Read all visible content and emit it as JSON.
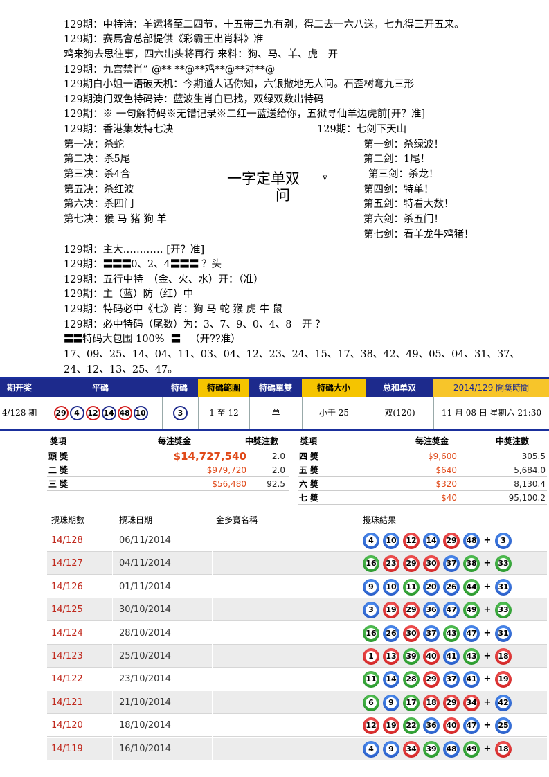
{
  "text_lines": {
    "l1": "129期：中特诗：羊运将至二四节，十五带三九有别，得二去一六八送，七九得三开五来。",
    "l2": "129期：赛馬會总部提供《彩霸王出肖料》准",
    "l3": "鸡来狗去思往事，四六出头将再行 来料：狗、马、羊、虎　开",
    "l4": "129期：九宫禁肖” @** **@**鸡**@**对**@",
    "l5": "129期白小姐一语破天机：今期道人话你知，六银撒地无人问。石歪树弯九三形",
    "l6": "129期澳门双色特码诗：蓝波生肖自已找，双绿双数出特码",
    "l7": "129期：※ 一句解特码※无错记录※二红一蓝送给你，五狱寻仙羊边虎前[开？准]",
    "l8a": "129期：香港集发特七决",
    "l8b": "129期：七剑下天山",
    "j1": "第一决：杀蛇",
    "j2": "第二决：杀5尾",
    "j3": "第三决：杀4合",
    "j4": "第五决：杀红波",
    "j5": "第六决：杀四门",
    "j6": "第七决：猴 马 猪 狗 羊",
    "s1": "第一剑：杀绿波！",
    "s2": "第二剑：1尾！",
    "s3": "第三剑：杀龙！",
    "s4": "第四剑：特单！",
    "s5": "第五剑：特看大数！",
    "s6": "第六剑：杀五门！",
    "s7": "第七剑：看羊龙牛鸡猪！",
    "big1": "一字定单双",
    "big2": "问",
    "vmark": "v",
    "m1": "129期：主大………… [开？准]",
    "m2a": "129期：",
    "m2bars1": "〓〓〓",
    "m2b": "0、2、4",
    "m2bars2": "〓〓〓",
    "m2c": " ？头",
    "m3": "129期：五行中特　（金、火、水）开：（准）",
    "m4": "129期：主（蓝）防（红）中",
    "m5": "129期：特码必中《七》肖：狗 马 蛇 猴 虎 牛 鼠",
    "m6": "129期：必中特码（尾数）为：3、7、9、0、4、8　开 ？",
    "m7bars1": "〓〓",
    "m7": "特码大包围 100%",
    "m7bars2": "〓",
    "m7c": "（开??准）",
    "m8": "17、09、25、14、04、11、03、04、12、23、24、15、17、38、42、49、05、04、31、37、",
    "m9": "24、12、13、25、47。"
  },
  "results_header": {
    "h_period": "期开奖",
    "h_normal": "平碼",
    "h_special": "特碼",
    "h_range": "特碼範圍",
    "h_oddeven": "特碼單雙",
    "h_size": "特碼大小",
    "h_sum": "总和单双",
    "h_next": "2014/129 開獎時間",
    "period": "4/128 期",
    "normal_balls": [
      "29",
      "4",
      "12",
      "14",
      "48",
      "10"
    ],
    "special_ball": "3",
    "range": "1 至 12",
    "oddeven": "单",
    "size": "小于 25",
    "sum": "双(120)",
    "next_time": "11 月 08 日 星期六 21:30"
  },
  "prize_table": {
    "left_headers": [
      "獎項",
      "每注獎金",
      "中獎注數"
    ],
    "right_headers": [
      "獎項",
      "每注獎金",
      "中獎注數"
    ],
    "left_rows": [
      {
        "name": "頭 獎",
        "amount": "$14,727,540",
        "count": "2.0"
      },
      {
        "name": "二 獎",
        "amount": "$979,720",
        "count": "2.0"
      },
      {
        "name": "三 獎",
        "amount": "$56,480",
        "count": "92.5"
      }
    ],
    "right_rows": [
      {
        "name": "四 獎",
        "amount": "$9,600",
        "count": "305.5"
      },
      {
        "name": "五 獎",
        "amount": "$640",
        "count": "5,684.0"
      },
      {
        "name": "六 獎",
        "amount": "$320",
        "count": "8,130.4"
      },
      {
        "name": "七 獎",
        "amount": "$40",
        "count": "95,100.2"
      }
    ]
  },
  "draws": {
    "headers": [
      "攪珠期數",
      "攪珠日期",
      "金多寶名稱",
      "攪珠結果"
    ],
    "rows": [
      {
        "period": "14/128",
        "date": "06/11/2014",
        "balls": [
          [
            "4",
            "blue"
          ],
          [
            "10",
            "blue"
          ],
          [
            "12",
            "red"
          ],
          [
            "14",
            "blue"
          ],
          [
            "29",
            "red"
          ],
          [
            "48",
            "blue"
          ]
        ],
        "special": [
          "3",
          "blue"
        ]
      },
      {
        "period": "14/127",
        "date": "04/11/2014",
        "balls": [
          [
            "16",
            "green"
          ],
          [
            "23",
            "red"
          ],
          [
            "29",
            "red"
          ],
          [
            "30",
            "red"
          ],
          [
            "37",
            "blue"
          ],
          [
            "38",
            "green"
          ]
        ],
        "special": [
          "33",
          "green"
        ]
      },
      {
        "period": "14/126",
        "date": "01/11/2014",
        "balls": [
          [
            "9",
            "blue"
          ],
          [
            "10",
            "blue"
          ],
          [
            "11",
            "green"
          ],
          [
            "20",
            "blue"
          ],
          [
            "26",
            "blue"
          ],
          [
            "44",
            "green"
          ]
        ],
        "special": [
          "31",
          "blue"
        ]
      },
      {
        "period": "14/125",
        "date": "30/10/2014",
        "balls": [
          [
            "3",
            "blue"
          ],
          [
            "19",
            "red"
          ],
          [
            "29",
            "red"
          ],
          [
            "36",
            "blue"
          ],
          [
            "47",
            "blue"
          ],
          [
            "49",
            "green"
          ]
        ],
        "special": [
          "33",
          "green"
        ]
      },
      {
        "period": "14/124",
        "date": "28/10/2014",
        "balls": [
          [
            "16",
            "green"
          ],
          [
            "26",
            "blue"
          ],
          [
            "30",
            "red"
          ],
          [
            "37",
            "blue"
          ],
          [
            "43",
            "green"
          ],
          [
            "47",
            "blue"
          ]
        ],
        "special": [
          "31",
          "blue"
        ]
      },
      {
        "period": "14/123",
        "date": "25/10/2014",
        "balls": [
          [
            "1",
            "red"
          ],
          [
            "13",
            "red"
          ],
          [
            "39",
            "green"
          ],
          [
            "40",
            "red"
          ],
          [
            "41",
            "blue"
          ],
          [
            "43",
            "green"
          ]
        ],
        "special": [
          "18",
          "red"
        ]
      },
      {
        "period": "14/122",
        "date": "23/10/2014",
        "balls": [
          [
            "11",
            "green"
          ],
          [
            "14",
            "blue"
          ],
          [
            "28",
            "green"
          ],
          [
            "29",
            "red"
          ],
          [
            "37",
            "blue"
          ],
          [
            "41",
            "blue"
          ]
        ],
        "special": [
          "19",
          "red"
        ]
      },
      {
        "period": "14/121",
        "date": "21/10/2014",
        "balls": [
          [
            "6",
            "green"
          ],
          [
            "9",
            "blue"
          ],
          [
            "17",
            "green"
          ],
          [
            "18",
            "red"
          ],
          [
            "29",
            "red"
          ],
          [
            "34",
            "red"
          ]
        ],
        "special": [
          "42",
          "blue"
        ]
      },
      {
        "period": "14/120",
        "date": "18/10/2014",
        "balls": [
          [
            "12",
            "red"
          ],
          [
            "19",
            "red"
          ],
          [
            "22",
            "green"
          ],
          [
            "36",
            "blue"
          ],
          [
            "40",
            "red"
          ],
          [
            "47",
            "blue"
          ]
        ],
        "special": [
          "25",
          "blue"
        ]
      },
      {
        "period": "14/119",
        "date": "16/10/2014",
        "balls": [
          [
            "4",
            "blue"
          ],
          [
            "9",
            "blue"
          ],
          [
            "34",
            "red"
          ],
          [
            "39",
            "green"
          ],
          [
            "48",
            "blue"
          ],
          [
            "49",
            "green"
          ]
        ],
        "special": [
          "18",
          "red"
        ]
      }
    ]
  },
  "colors": {
    "navy": "#1d2a8c",
    "gold": "#f5c400",
    "red": "#c41010",
    "blue": "#1848b8",
    "green": "#15871a",
    "amount": "#e04a1a"
  }
}
